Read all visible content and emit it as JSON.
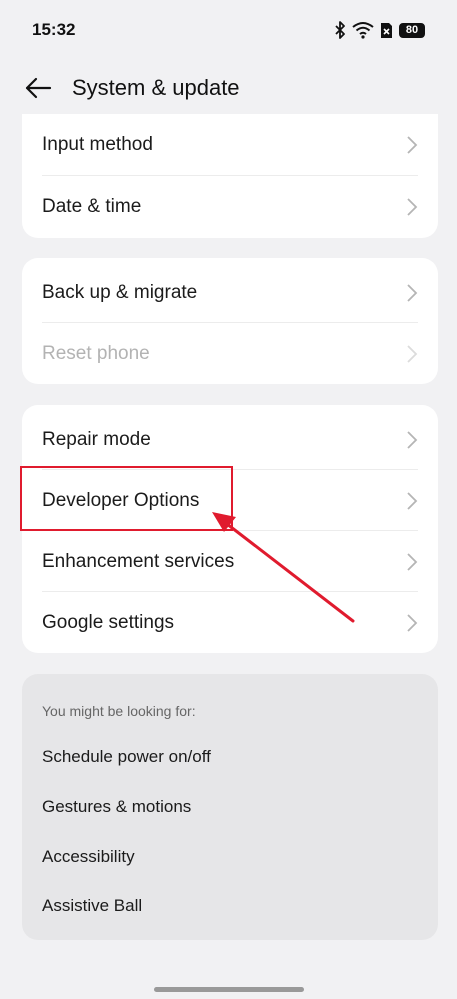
{
  "status_bar": {
    "time": "15:32",
    "battery": "80"
  },
  "header": {
    "title": "System & update"
  },
  "card1": {
    "items": [
      {
        "label": "Input method"
      },
      {
        "label": "Date & time"
      }
    ]
  },
  "card2": {
    "items": [
      {
        "label": "Back up & migrate"
      },
      {
        "label": "Reset phone"
      }
    ]
  },
  "card3": {
    "items": [
      {
        "label": "Repair mode"
      },
      {
        "label": "Developer Options"
      },
      {
        "label": "Enhancement services"
      },
      {
        "label": "Google settings"
      }
    ]
  },
  "suggestions": {
    "title": "You might be looking for:",
    "items": [
      {
        "label": "Schedule power on/off"
      },
      {
        "label": "Gestures & motions"
      },
      {
        "label": "Accessibility"
      },
      {
        "label": "Assistive Ball"
      }
    ]
  },
  "annotation": {
    "color": "#e01b2e"
  }
}
